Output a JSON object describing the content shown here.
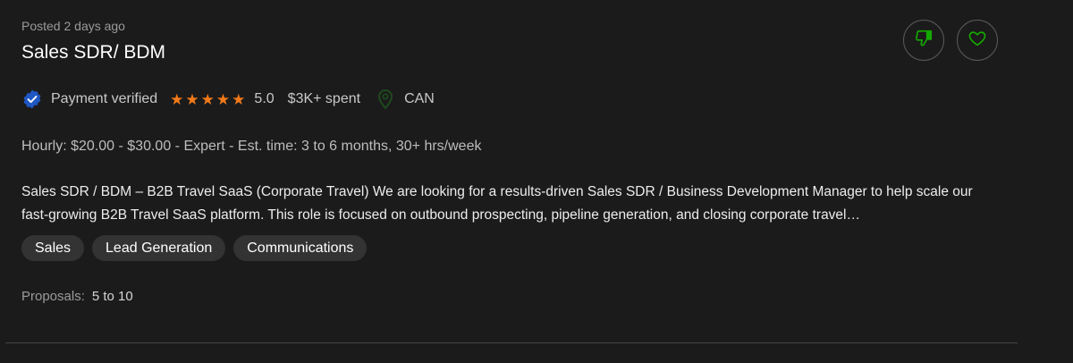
{
  "job": {
    "posted": "Posted 2 days ago",
    "title": "Sales SDR/ BDM",
    "payment_status": "Payment verified",
    "rating": 5.0,
    "rating_text": "5.0",
    "spent": "$3K+ spent",
    "country": "CAN",
    "terms": "Hourly: $20.00 - $30.00 - Expert - Est. time: 3 to 6 months, 30+ hrs/week",
    "description": "Sales SDR / BDM – B2B Travel SaaS (Corporate Travel) We are looking for a results-driven Sales SDR / Business Development Manager to help scale our fast-growing B2B Travel SaaS platform. This role is focused on outbound prospecting, pipeline generation, and closing corporate travel…",
    "skills": [
      "Sales",
      "Lead Generation",
      "Communications"
    ],
    "proposals_label": "Proposals:",
    "proposals_value": "5 to 10"
  },
  "icons": {
    "dislike": "thumbs-down-icon",
    "save": "heart-icon",
    "verified": "verified-badge-icon",
    "star": "star-icon",
    "location": "location-pin-icon"
  },
  "colors": {
    "background": "#1b1b1b",
    "accent_green": "#14a800",
    "star_orange": "#f27a1a",
    "verified_blue": "#1f57c3",
    "chip_bg": "#333333"
  }
}
